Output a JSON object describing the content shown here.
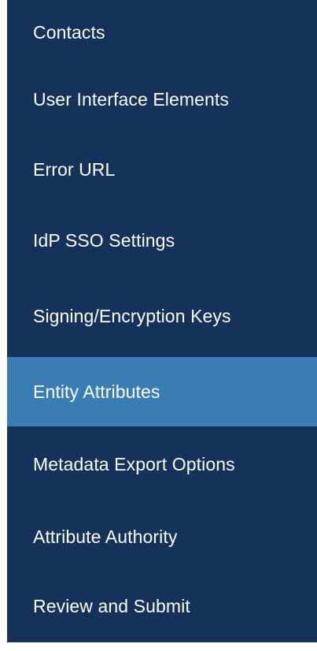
{
  "sidebar": {
    "items": [
      {
        "label": "Contacts",
        "active": false
      },
      {
        "label": "User Interface Elements",
        "active": false
      },
      {
        "label": "Error URL",
        "active": false
      },
      {
        "label": "IdP SSO Settings",
        "active": false
      },
      {
        "label": "Signing/Encryption Keys",
        "active": false
      },
      {
        "label": "Entity Attributes",
        "active": true
      },
      {
        "label": "Metadata Export Options",
        "active": false
      },
      {
        "label": "Attribute Authority",
        "active": false
      },
      {
        "label": "Review and Submit",
        "active": false
      }
    ],
    "colors": {
      "background": "#14325a",
      "active_background": "#3a7db4",
      "text": "#ffffff"
    }
  }
}
